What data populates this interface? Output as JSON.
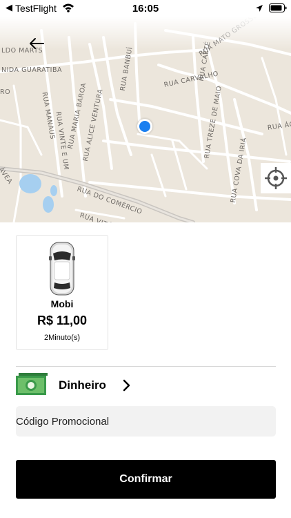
{
  "status_bar": {
    "back_glyph": "◀",
    "app": "TestFlight",
    "time": "16:05"
  },
  "map": {
    "streets": [
      "LDO MARTS",
      "NIDA GUARATIBA",
      "RUA BANBUÍ",
      "RUA CAETÉ",
      "RUA MATO GROSSO",
      "RUA CARVALHO",
      "RUA MANAUS",
      "RUA VINTE E UM",
      "RUA MARIA BAROA",
      "RUA ALICE VENTURA",
      "RUA TREZE DE MAIO",
      "RUA ÁG",
      "RUA COVA DA IRIÁ",
      "RUA DO COMÉRCIO",
      "ÁVEA",
      "RUA VITÓRI",
      "RO"
    ],
    "icons": [
      "arrow-left-icon",
      "location-dot",
      "crosshair-icon"
    ]
  },
  "vehicle": {
    "name": "Mobi",
    "price": "R$ 11,00",
    "eta": "2Minuto(s)"
  },
  "payment": {
    "label": "Dinheiro",
    "icon": "cash-icon"
  },
  "promo": {
    "label": "Código Promocional"
  },
  "confirm": {
    "label": "Confirmar"
  },
  "colors": {
    "accent": "#1a7ff0",
    "cash_green": "#3a9a4a",
    "button": "#000000"
  }
}
